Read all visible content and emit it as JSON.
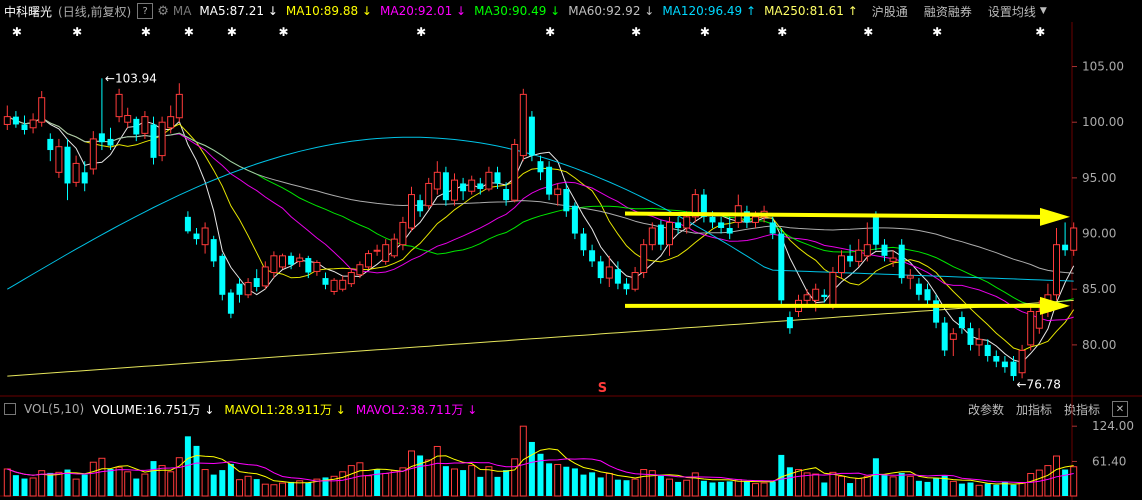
{
  "ma_header": {
    "stock_name": "中科曙光",
    "period": "(日线,前复权)",
    "help_icon_text": "?",
    "ma_label": "MA",
    "ma_items": [
      {
        "text": "MA5:87.21",
        "arrow": "↓",
        "color": "#ffffff"
      },
      {
        "text": "MA10:89.88",
        "arrow": "↓",
        "color": "#ffff00"
      },
      {
        "text": "MA20:92.01",
        "arrow": "↓",
        "color": "#ff00ff"
      },
      {
        "text": "MA30:90.49",
        "arrow": "↓",
        "color": "#00ff00"
      },
      {
        "text": "MA60:92.92",
        "arrow": "↓",
        "color": "#bfbfbf"
      },
      {
        "text": "MA120:96.49",
        "arrow": "↑",
        "color": "#00d8ff"
      },
      {
        "text": "MA250:81.61",
        "arrow": "↑",
        "color": "#ffff66"
      }
    ],
    "menu": {
      "hgt": "沪股通",
      "margin": "融资融券",
      "set_ma": "设置均线"
    }
  },
  "vol_header": {
    "label": "VOL(5,10)",
    "items": [
      {
        "text": "VOLUME:16.751万",
        "arrow": "↓",
        "color": "#ffffff"
      },
      {
        "text": "MAVOL1:28.911万",
        "arrow": "↓",
        "color": "#ffff00"
      },
      {
        "text": "MAVOL2:38.711万",
        "arrow": "↓",
        "color": "#ff00ff"
      }
    ],
    "tools": {
      "change_params": "改参数",
      "add_indicator": "加指标",
      "switch_indicator": "换指标",
      "close": "✕"
    }
  },
  "chart_data": {
    "type": "candlestick",
    "price_axis": {
      "ticks": [
        105,
        100,
        95,
        90,
        85,
        80
      ],
      "labels": [
        "105.00",
        "100.00",
        "95.00",
        "90.00",
        "85.00",
        "80.00"
      ],
      "range": [
        75.5,
        109
      ]
    },
    "volume_axis": {
      "ticks": [
        124,
        61.4
      ],
      "labels": [
        "124.00",
        "61.40"
      ],
      "range": [
        0,
        135
      ]
    },
    "annotations": {
      "high": "103.94",
      "low": "76.78",
      "marker": "S"
    },
    "candles": [
      [
        99.8,
        100.5,
        101.5,
        99.3
      ],
      [
        100.5,
        99.8,
        101.0,
        99.5
      ],
      [
        99.8,
        99.3,
        100.6,
        98.9
      ],
      [
        99.5,
        100.2,
        100.8,
        99.0
      ],
      [
        100.0,
        102.2,
        102.8,
        99.6
      ],
      [
        98.5,
        97.5,
        99.0,
        96.5
      ],
      [
        95.5,
        97.8,
        98.5,
        95.0
      ],
      [
        97.8,
        94.5,
        98.5,
        93.0
      ],
      [
        94.6,
        96.3,
        97.0,
        94.2
      ],
      [
        95.5,
        94.5,
        96.5,
        93.8
      ],
      [
        95.8,
        98.5,
        99.2,
        95.3
      ],
      [
        99.0,
        98.2,
        103.94,
        97.5
      ],
      [
        98.5,
        97.9,
        99.5,
        97.5
      ],
      [
        100.5,
        102.5,
        103.0,
        100.0
      ],
      [
        100.0,
        100.6,
        101.3,
        99.5
      ],
      [
        100.3,
        98.9,
        100.5,
        98.3
      ],
      [
        99.0,
        100.5,
        101.0,
        98.5
      ],
      [
        99.8,
        96.8,
        100.5,
        96.2
      ],
      [
        97.0,
        100.0,
        100.5,
        96.5
      ],
      [
        99.5,
        100.5,
        101.5,
        99.0
      ],
      [
        100.4,
        102.5,
        103.5,
        100.0
      ],
      [
        91.5,
        90.2,
        92.0,
        90.0
      ],
      [
        90.0,
        89.5,
        90.5,
        89.0
      ],
      [
        89.0,
        90.5,
        91.0,
        88.2
      ],
      [
        89.5,
        87.5,
        89.8,
        87.0
      ],
      [
        88.0,
        84.5,
        88.2,
        84.0
      ],
      [
        84.7,
        82.8,
        85.0,
        82.4
      ],
      [
        85.5,
        84.5,
        86.0,
        83.8
      ],
      [
        84.5,
        85.6,
        86.0,
        84.2
      ],
      [
        86.0,
        85.2,
        86.8,
        84.8
      ],
      [
        85.3,
        87.0,
        87.5,
        85.0
      ],
      [
        86.5,
        88.0,
        88.4,
        86.0
      ],
      [
        87.0,
        88.0,
        88.2,
        86.8
      ],
      [
        88.0,
        87.2,
        88.3,
        86.8
      ],
      [
        87.5,
        87.8,
        88.2,
        87.0
      ],
      [
        87.8,
        86.5,
        88.0,
        86.0
      ],
      [
        86.6,
        87.4,
        87.6,
        86.2
      ],
      [
        86.0,
        85.4,
        86.5,
        85.0
      ],
      [
        84.8,
        85.8,
        86.0,
        84.5
      ],
      [
        85.0,
        85.8,
        86.2,
        84.8
      ],
      [
        85.5,
        86.5,
        86.8,
        85.2
      ],
      [
        86.3,
        87.2,
        87.5,
        86.0
      ],
      [
        87.0,
        88.2,
        88.5,
        86.8
      ],
      [
        88.5,
        88.5,
        89.0,
        88.0
      ],
      [
        87.5,
        89.0,
        89.5,
        87.2
      ],
      [
        88.0,
        89.5,
        90.0,
        87.8
      ],
      [
        89.0,
        91.0,
        91.5,
        88.5
      ],
      [
        90.5,
        93.5,
        94.2,
        90.2
      ],
      [
        93.0,
        92.0,
        93.5,
        91.5
      ],
      [
        92.5,
        94.5,
        95.0,
        92.2
      ],
      [
        94.0,
        95.5,
        96.5,
        93.5
      ],
      [
        95.5,
        93.0,
        96.0,
        92.5
      ],
      [
        93.0,
        94.8,
        95.4,
        92.5
      ],
      [
        94.5,
        93.8,
        95.0,
        93.0
      ],
      [
        93.8,
        94.8,
        95.2,
        93.5
      ],
      [
        94.5,
        94.0,
        95.0,
        93.5
      ],
      [
        94.0,
        95.5,
        96.0,
        93.8
      ],
      [
        95.5,
        94.5,
        96.0,
        94.0
      ],
      [
        94.0,
        93.0,
        94.6,
        92.5
      ],
      [
        93.0,
        98.0,
        98.5,
        92.8
      ],
      [
        97.0,
        102.5,
        103.0,
        96.5
      ],
      [
        100.5,
        97.0,
        101.0,
        96.5
      ],
      [
        96.5,
        95.5,
        97.0,
        94.8
      ],
      [
        96.0,
        93.5,
        96.5,
        93.0
      ],
      [
        93.5,
        94.0,
        94.5,
        92.5
      ],
      [
        94.0,
        92.0,
        94.5,
        91.5
      ],
      [
        92.5,
        90.0,
        92.8,
        89.5
      ],
      [
        90.0,
        88.5,
        90.5,
        88.0
      ],
      [
        88.5,
        87.5,
        89.0,
        87.0
      ],
      [
        87.5,
        86.0,
        88.0,
        85.5
      ],
      [
        86.0,
        87.0,
        88.0,
        85.2
      ],
      [
        86.8,
        85.5,
        87.5,
        85.0
      ],
      [
        85.5,
        85.0,
        86.0,
        84.5
      ],
      [
        85.0,
        86.5,
        87.0,
        84.8
      ],
      [
        86.5,
        89.0,
        89.5,
        86.0
      ],
      [
        89.0,
        90.5,
        91.0,
        88.5
      ],
      [
        90.8,
        89.0,
        91.2,
        88.5
      ],
      [
        89.0,
        91.0,
        91.5,
        88.0
      ],
      [
        91.0,
        90.5,
        91.5,
        90.0
      ],
      [
        90.5,
        91.5,
        92.0,
        90.0
      ],
      [
        91.5,
        93.5,
        94.0,
        91.0
      ],
      [
        93.5,
        91.5,
        94.0,
        91.0
      ],
      [
        91.5,
        91.0,
        92.0,
        90.5
      ],
      [
        91.0,
        90.5,
        91.5,
        90.0
      ],
      [
        90.5,
        90.0,
        91.5,
        89.5
      ],
      [
        91.0,
        92.5,
        93.5,
        90.5
      ],
      [
        92.0,
        91.0,
        92.5,
        90.5
      ],
      [
        91.0,
        91.5,
        92.0,
        90.5
      ],
      [
        91.5,
        92.0,
        92.5,
        91.0
      ],
      [
        91.0,
        90.0,
        91.5,
        89.5
      ],
      [
        90.0,
        84.0,
        90.5,
        83.5
      ],
      [
        82.5,
        81.5,
        83.0,
        81.0
      ],
      [
        83.0,
        84.0,
        84.5,
        82.5
      ],
      [
        84.0,
        84.5,
        85.0,
        83.5
      ],
      [
        84.0,
        85.0,
        85.5,
        83.0
      ],
      [
        84.5,
        84.3,
        85.0,
        83.8
      ],
      [
        83.5,
        86.5,
        87.0,
        83.2
      ],
      [
        86.5,
        88.0,
        88.5,
        86.0
      ],
      [
        88.0,
        87.5,
        89.0,
        87.0
      ],
      [
        87.5,
        88.5,
        89.5,
        87.0
      ],
      [
        88.0,
        89.0,
        91.0,
        87.5
      ],
      [
        91.5,
        89.0,
        92.0,
        88.5
      ],
      [
        89.0,
        88.0,
        89.5,
        87.5
      ],
      [
        87.5,
        87.8,
        88.5,
        87.0
      ],
      [
        89.0,
        86.0,
        89.5,
        85.5
      ],
      [
        86.0,
        86.2,
        86.8,
        85.0
      ],
      [
        85.5,
        84.5,
        86.0,
        84.0
      ],
      [
        85.0,
        84.0,
        85.5,
        83.5
      ],
      [
        84.0,
        82.0,
        84.5,
        81.5
      ],
      [
        82.0,
        79.5,
        82.5,
        79.0
      ],
      [
        80.5,
        81.0,
        81.5,
        79.0
      ],
      [
        82.5,
        81.5,
        83.0,
        81.0
      ],
      [
        81.5,
        80.0,
        82.0,
        79.5
      ],
      [
        80.0,
        80.5,
        81.5,
        79.0
      ],
      [
        80.0,
        79.0,
        80.5,
        78.5
      ],
      [
        79.0,
        78.5,
        79.5,
        78.0
      ],
      [
        78.5,
        78.0,
        79.0,
        77.5
      ],
      [
        78.5,
        77.2,
        79.0,
        76.78
      ],
      [
        77.5,
        79.5,
        80.0,
        77.0
      ],
      [
        80.0,
        83.0,
        83.5,
        79.5
      ],
      [
        81.5,
        83.0,
        84.0,
        81.0
      ],
      [
        83.0,
        84.5,
        85.5,
        82.5
      ],
      [
        84.5,
        89.0,
        90.5,
        84.0
      ],
      [
        89.0,
        88.5,
        91.0,
        88.0
      ],
      [
        88.5,
        90.5,
        91.0,
        88.0
      ]
    ],
    "volumes": [
      {
        "v": 48,
        "up": true
      },
      {
        "v": 37,
        "up": false
      },
      {
        "v": 31,
        "up": false
      },
      {
        "v": 32,
        "up": true
      },
      {
        "v": 45,
        "up": true
      },
      {
        "v": 41,
        "up": false
      },
      {
        "v": 42,
        "up": true
      },
      {
        "v": 47,
        "up": false
      },
      {
        "v": 30,
        "up": true
      },
      {
        "v": 38,
        "up": false
      },
      {
        "v": 60,
        "up": true
      },
      {
        "v": 67,
        "up": true
      },
      {
        "v": 48,
        "up": false
      },
      {
        "v": 51,
        "up": true
      },
      {
        "v": 43,
        "up": true
      },
      {
        "v": 31,
        "up": false
      },
      {
        "v": 39,
        "up": true
      },
      {
        "v": 62,
        "up": false
      },
      {
        "v": 54,
        "up": true
      },
      {
        "v": 43,
        "up": true
      },
      {
        "v": 68,
        "up": true
      },
      {
        "v": 106,
        "up": false
      },
      {
        "v": 89,
        "up": false
      },
      {
        "v": 47,
        "up": true
      },
      {
        "v": 38,
        "up": false
      },
      {
        "v": 46,
        "up": false
      },
      {
        "v": 57,
        "up": false
      },
      {
        "v": 29,
        "up": true
      },
      {
        "v": 35,
        "up": true
      },
      {
        "v": 30,
        "up": false
      },
      {
        "v": 21,
        "up": true
      },
      {
        "v": 20,
        "up": true
      },
      {
        "v": 23,
        "up": true
      },
      {
        "v": 25,
        "up": false
      },
      {
        "v": 27,
        "up": true
      },
      {
        "v": 24,
        "up": false
      },
      {
        "v": 30,
        "up": true
      },
      {
        "v": 33,
        "up": false
      },
      {
        "v": 35,
        "up": true
      },
      {
        "v": 43,
        "up": true
      },
      {
        "v": 54,
        "up": true
      },
      {
        "v": 59,
        "up": true
      },
      {
        "v": 36,
        "up": true
      },
      {
        "v": 47,
        "up": false
      },
      {
        "v": 40,
        "up": true
      },
      {
        "v": 45,
        "up": true
      },
      {
        "v": 50,
        "up": true
      },
      {
        "v": 80,
        "up": true
      },
      {
        "v": 72,
        "up": false
      },
      {
        "v": 64,
        "up": true
      },
      {
        "v": 88,
        "up": true
      },
      {
        "v": 53,
        "up": false
      },
      {
        "v": 48,
        "up": true
      },
      {
        "v": 46,
        "up": false
      },
      {
        "v": 54,
        "up": true
      },
      {
        "v": 34,
        "up": false
      },
      {
        "v": 52,
        "up": true
      },
      {
        "v": 34,
        "up": false
      },
      {
        "v": 46,
        "up": false
      },
      {
        "v": 66,
        "up": true
      },
      {
        "v": 124,
        "up": true
      },
      {
        "v": 96,
        "up": false
      },
      {
        "v": 75,
        "up": false
      },
      {
        "v": 58,
        "up": false
      },
      {
        "v": 56,
        "up": true
      },
      {
        "v": 52,
        "up": false
      },
      {
        "v": 49,
        "up": false
      },
      {
        "v": 38,
        "up": false
      },
      {
        "v": 42,
        "up": false
      },
      {
        "v": 33,
        "up": false
      },
      {
        "v": 40,
        "up": true
      },
      {
        "v": 29,
        "up": false
      },
      {
        "v": 28,
        "up": false
      },
      {
        "v": 30,
        "up": true
      },
      {
        "v": 47,
        "up": true
      },
      {
        "v": 45,
        "up": true
      },
      {
        "v": 36,
        "up": false
      },
      {
        "v": 30,
        "up": true
      },
      {
        "v": 25,
        "up": false
      },
      {
        "v": 28,
        "up": true
      },
      {
        "v": 41,
        "up": true
      },
      {
        "v": 27,
        "up": false
      },
      {
        "v": 24,
        "up": false
      },
      {
        "v": 25,
        "up": false
      },
      {
        "v": 26,
        "up": false
      },
      {
        "v": 29,
        "up": true
      },
      {
        "v": 26,
        "up": false
      },
      {
        "v": 22,
        "up": true
      },
      {
        "v": 23,
        "up": true
      },
      {
        "v": 26,
        "up": false
      },
      {
        "v": 73,
        "up": false
      },
      {
        "v": 51,
        "up": false
      },
      {
        "v": 47,
        "up": true
      },
      {
        "v": 41,
        "up": true
      },
      {
        "v": 39,
        "up": true
      },
      {
        "v": 24,
        "up": false
      },
      {
        "v": 42,
        "up": true
      },
      {
        "v": 35,
        "up": true
      },
      {
        "v": 23,
        "up": false
      },
      {
        "v": 31,
        "up": true
      },
      {
        "v": 35,
        "up": true
      },
      {
        "v": 67,
        "up": false
      },
      {
        "v": 38,
        "up": false
      },
      {
        "v": 34,
        "up": true
      },
      {
        "v": 41,
        "up": false
      },
      {
        "v": 35,
        "up": true
      },
      {
        "v": 27,
        "up": false
      },
      {
        "v": 25,
        "up": false
      },
      {
        "v": 32,
        "up": false
      },
      {
        "v": 36,
        "up": false
      },
      {
        "v": 26,
        "up": true
      },
      {
        "v": 22,
        "up": false
      },
      {
        "v": 24,
        "up": false
      },
      {
        "v": 19,
        "up": true
      },
      {
        "v": 22,
        "up": false
      },
      {
        "v": 20,
        "up": false
      },
      {
        "v": 25,
        "up": false
      },
      {
        "v": 20,
        "up": false
      },
      {
        "v": 24,
        "up": true
      },
      {
        "v": 40,
        "up": true
      },
      {
        "v": 46,
        "up": true
      },
      {
        "v": 54,
        "up": true
      },
      {
        "v": 71,
        "up": true
      },
      {
        "v": 47,
        "up": false
      },
      {
        "v": 52,
        "up": true
      }
    ],
    "trend_lines": [
      {
        "from_candle": 108,
        "to_candle": 124,
        "price": 91.5,
        "start_price": 91.8,
        "color": "#ffff00"
      },
      {
        "from_candle": 108,
        "to_candle": 124,
        "price": 83.5,
        "start_price": 83.5,
        "color": "#ffff00"
      }
    ],
    "star_markers": [
      1,
      8,
      16,
      21,
      26,
      32,
      48,
      63,
      73,
      81,
      90,
      100,
      108,
      120
    ]
  }
}
